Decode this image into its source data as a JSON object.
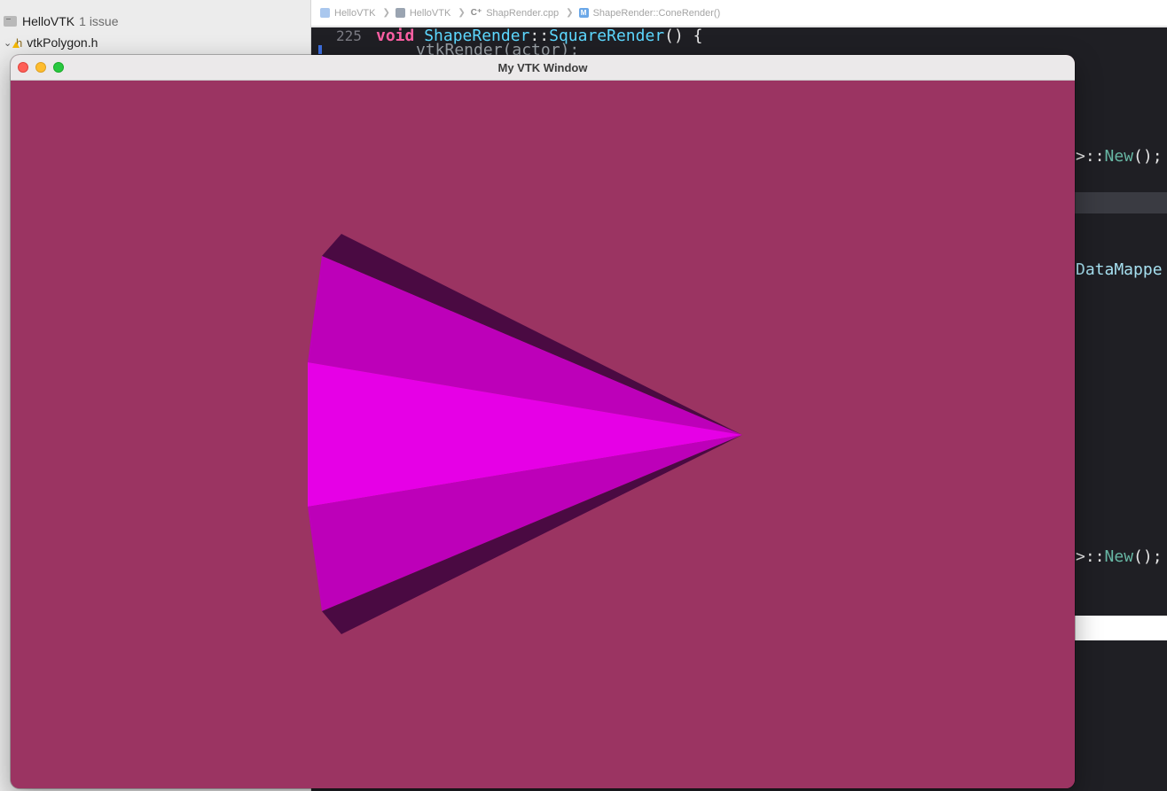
{
  "navigator": {
    "project_name": "HelloVTK",
    "issue_count": "1 issue",
    "file_name": "vtkPolygon.h",
    "file_icon_glyph": "h"
  },
  "jumpbar": {
    "crumbs": [
      {
        "label": "HelloVTK",
        "icon": "project-icon"
      },
      {
        "label": "HelloVTK",
        "icon": "folder-icon"
      },
      {
        "label": "ShapRender.cpp",
        "icon": "cpp-file-icon",
        "glyph": "C⁺"
      },
      {
        "label": "ShapeRender::ConeRender()",
        "icon": "method-icon",
        "glyph": "M"
      }
    ],
    "separator": "❯"
  },
  "editor": {
    "line_number": "225",
    "code_keyword": "void",
    "code_class": "ShapeRender",
    "code_scope": "::",
    "code_method": "SquareRender",
    "code_rest": "() {",
    "partial_line": "vtkRender(actor);",
    "fragment_1_prefix": ">::",
    "fragment_1_call": "New",
    "fragment_1_suffix": "();",
    "fragment_2": "DataMappe",
    "fragment_3_prefix": ">::",
    "fragment_3_call": "New",
    "fragment_3_suffix": "();"
  },
  "vtk_window": {
    "title": "My VTK Window",
    "background_color": "#9b3462",
    "cone_colors": {
      "dark": "#4a0a42",
      "medium": "#bd00b9",
      "bright": "#e600e6"
    }
  }
}
